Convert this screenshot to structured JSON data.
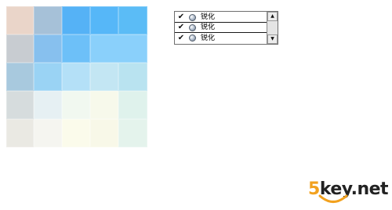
{
  "color_grid": {
    "cells": [
      "#ead5c9",
      "#a6c1d8",
      "#55b2f6",
      "#56b7f8",
      "#5bbcf6",
      "#c8ccd1",
      "#87c0ee",
      "#6dc0f8",
      "#8ad0fb",
      "#a8c9de",
      "#9ad3f4",
      "#b4e0f7",
      "#c3e6f3",
      "#b9e3f0",
      "#d6dcdd",
      "#e6f0f3",
      "#f1f8f0",
      "#f7f9eb",
      "#dff2ec",
      "#eae9e3",
      "#f5f5f0",
      "#fbfbeb",
      "#f8f8e8",
      "#e4f3ec"
    ],
    "merged_index": 8
  },
  "layer_panel": {
    "rows": [
      {
        "check": "✔",
        "icon": "effect-icon",
        "label": "锐化"
      },
      {
        "check": "✔",
        "icon": "effect-icon",
        "label": "锐化"
      },
      {
        "check": "✔",
        "icon": "effect-icon",
        "label": "锐化"
      }
    ],
    "scroll_up": "▲",
    "scroll_down": "▼"
  },
  "watermark": {
    "five": "5",
    "rest": "key.net",
    "colors": {
      "accent": "#f2a11e",
      "dark": "#222222"
    }
  }
}
